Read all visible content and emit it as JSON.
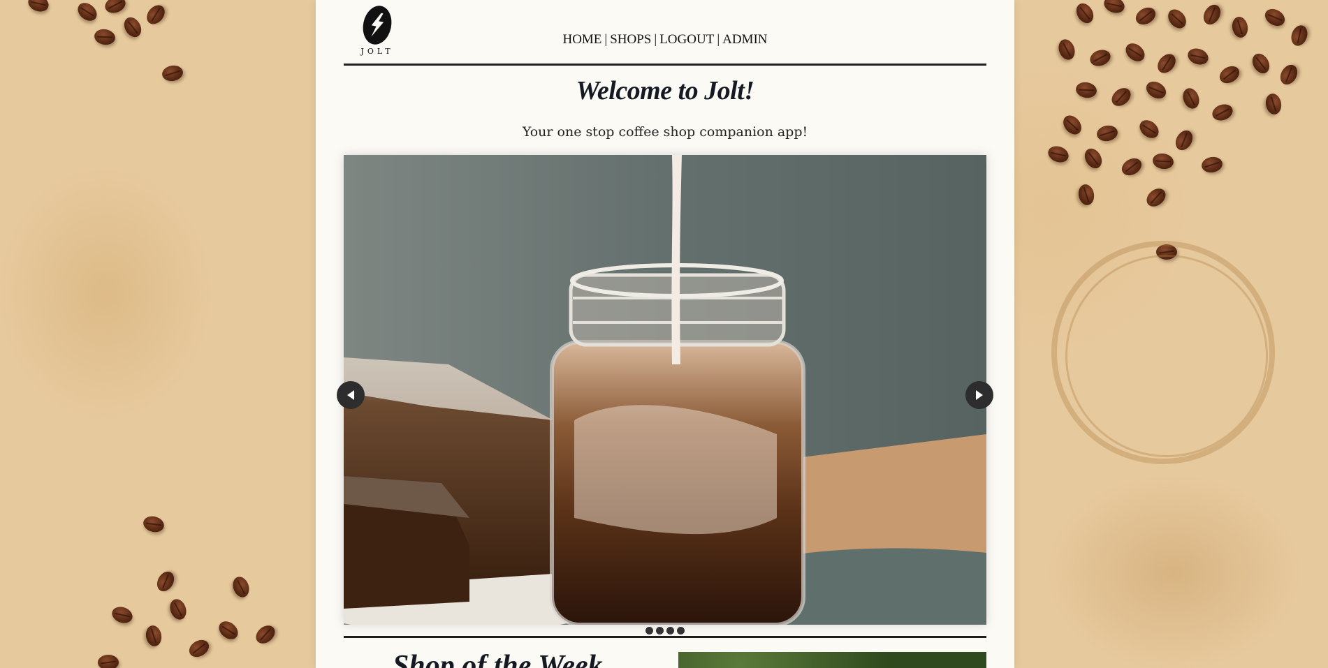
{
  "brand": {
    "name": "JOLT"
  },
  "nav": {
    "items": [
      {
        "label": "HOME"
      },
      {
        "label": "SHOPS"
      },
      {
        "label": "LOGOUT"
      },
      {
        "label": "ADMIN"
      }
    ],
    "separator": "|"
  },
  "hero": {
    "title": "Welcome to Jolt!",
    "tagline": "Your one stop coffee shop companion app!"
  },
  "carousel": {
    "slide_count": 4,
    "active_slide": 1,
    "image": "iced-coffee-with-milk-pour-icon"
  },
  "next_section": {
    "title": "Shop of the Week"
  },
  "colors": {
    "background": "#e6c99d",
    "panel": "#fcfaf5",
    "text": "#151a22",
    "rule": "#1d1d1d"
  }
}
